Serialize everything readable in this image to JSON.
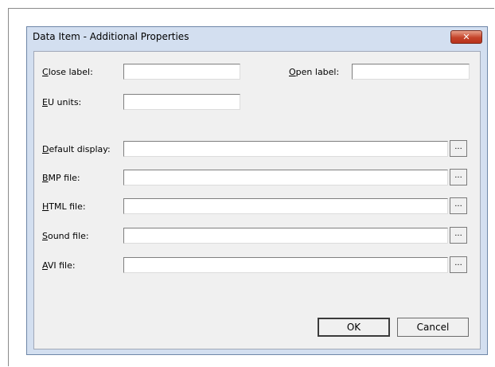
{
  "window": {
    "title": "Data Item - Additional Properties",
    "close_glyph": "✕"
  },
  "fields": {
    "close_label": {
      "prefix": "C",
      "rest": "lose label:",
      "value": ""
    },
    "open_label": {
      "prefix": "O",
      "rest": "pen label:",
      "value": ""
    },
    "eu_units": {
      "prefix": "E",
      "rest": "U units:",
      "value": ""
    },
    "default_display": {
      "prefix": "D",
      "rest": "efault display:",
      "value": ""
    },
    "bmp_file": {
      "prefix": "B",
      "rest": "MP file:",
      "value": ""
    },
    "html_file": {
      "prefix": "H",
      "rest": "TML file:",
      "value": ""
    },
    "sound_file": {
      "prefix": "S",
      "rest": "ound file:",
      "value": ""
    },
    "avi_file": {
      "prefix": "A",
      "rest": "VI file:",
      "value": ""
    }
  },
  "browse_label": "...",
  "buttons": {
    "ok": "OK",
    "cancel": "Cancel"
  }
}
